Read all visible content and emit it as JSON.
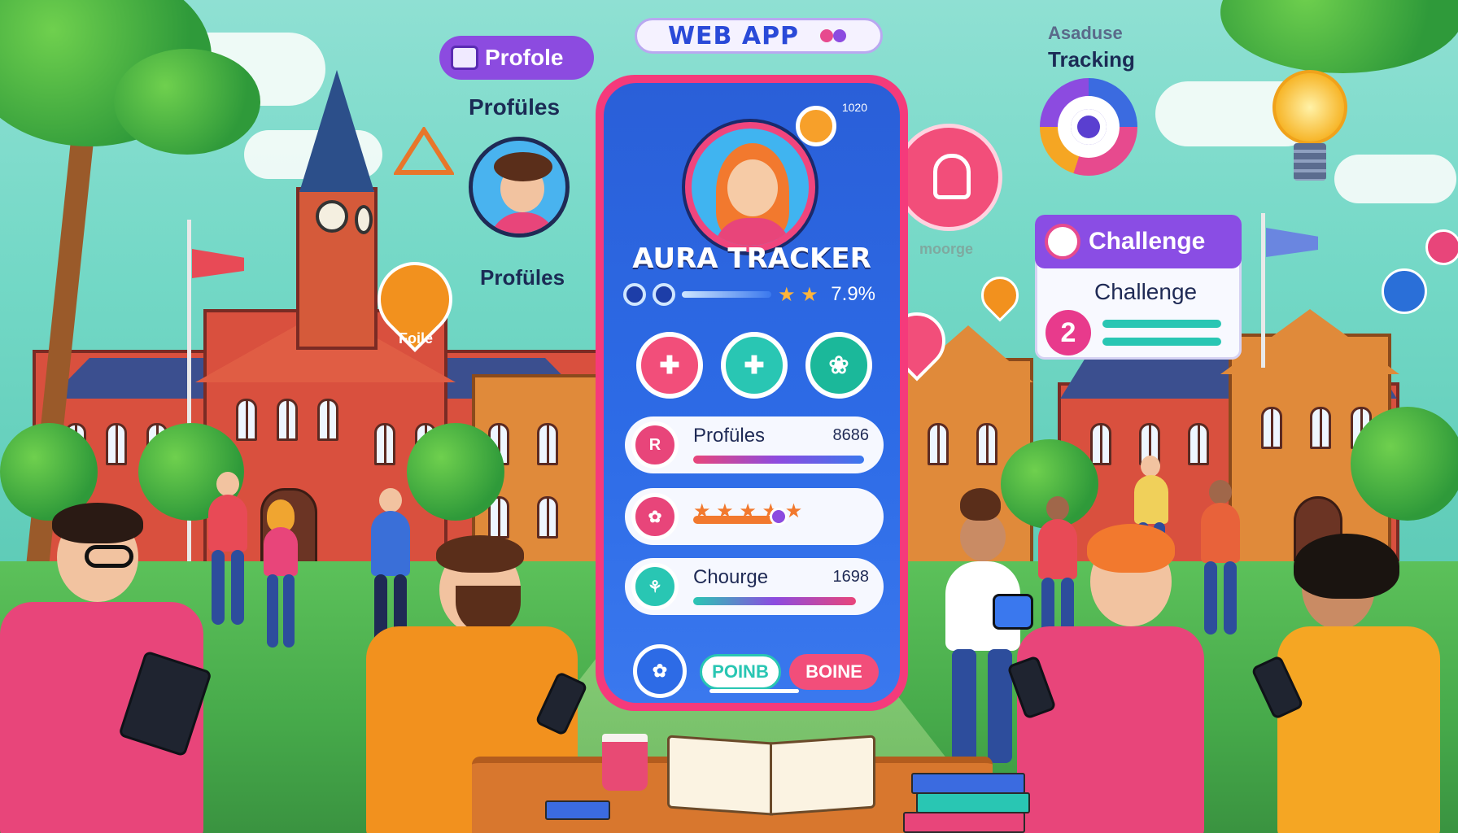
{
  "header": {
    "chip_label": "WEB   APP",
    "profile_pill": "Profole",
    "tracking_top": "Asaduse",
    "tracking_bottom": "Tracking"
  },
  "floating": {
    "profiles_top": "Profüles",
    "profiles_side": "Profüles",
    "pin_label": "Foile",
    "faint_label": "moorge"
  },
  "challenge": {
    "title": "Challenge",
    "subtitle": "Challenge",
    "count": "2"
  },
  "app": {
    "status_number": "1020",
    "title": "AURA TRACKER",
    "stats": {
      "stars": "★ ★",
      "percent": "7.9%"
    },
    "rows": [
      {
        "icon_letter": "R",
        "label": "Profüles",
        "value": "8686",
        "progress": 0.85
      },
      {
        "icon_letter": "",
        "label": "",
        "value": "",
        "rating_stars": "★ ★ ★ ★ ★",
        "progress": 0.45
      },
      {
        "icon_letter": "",
        "label": "Chourge",
        "value": "1698",
        "progress": 0.8
      }
    ],
    "buttons": {
      "points": "POINB",
      "boine": "BOINE"
    }
  },
  "colors": {
    "accent_pink": "#f53a7b",
    "screen_blue": "#2d6be6",
    "purple": "#8c4be0",
    "teal": "#29c6b3"
  },
  "icons": [
    "profile-icon",
    "target-icon",
    "lightbulb-icon",
    "challenge-icon",
    "location-pin-icon",
    "avatar-icon",
    "sun-badge-icon",
    "warning-triangle-icon"
  ]
}
